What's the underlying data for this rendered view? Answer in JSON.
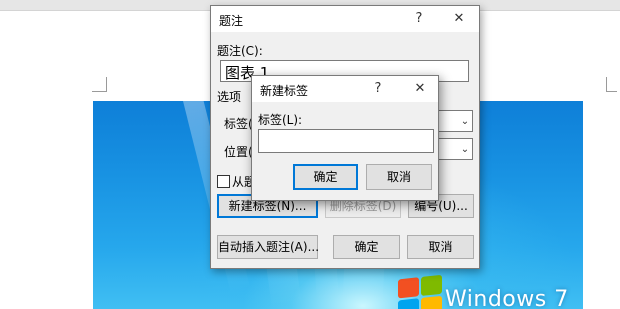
{
  "wallpaper": {
    "brand_text": "Windows 7"
  },
  "caption_dialog": {
    "title": "题注",
    "help_icon": "?",
    "close_icon": "✕",
    "caption_label": "题注(C):",
    "caption_value": "图表 1",
    "options_label": "选项",
    "label_label": "标签(L",
    "position_label": "位置(P",
    "exclude_label": "从题",
    "new_label_button": "新建标签(N)...",
    "delete_label_button": "删除标签(D)",
    "numbering_button": "编号(U)...",
    "autocaption_button": "自动插入题注(A)...",
    "ok_button": "确定",
    "cancel_button": "取消"
  },
  "new_label_dialog": {
    "title": "新建标签",
    "help_icon": "?",
    "close_icon": "✕",
    "label_label": "标签(L):",
    "label_value": "",
    "ok_button": "确定",
    "cancel_button": "取消"
  },
  "colors": {
    "accent": "#0078d7",
    "dialog_bg": "#f0f0f0",
    "wallpaper_blue": "#1892e2"
  }
}
